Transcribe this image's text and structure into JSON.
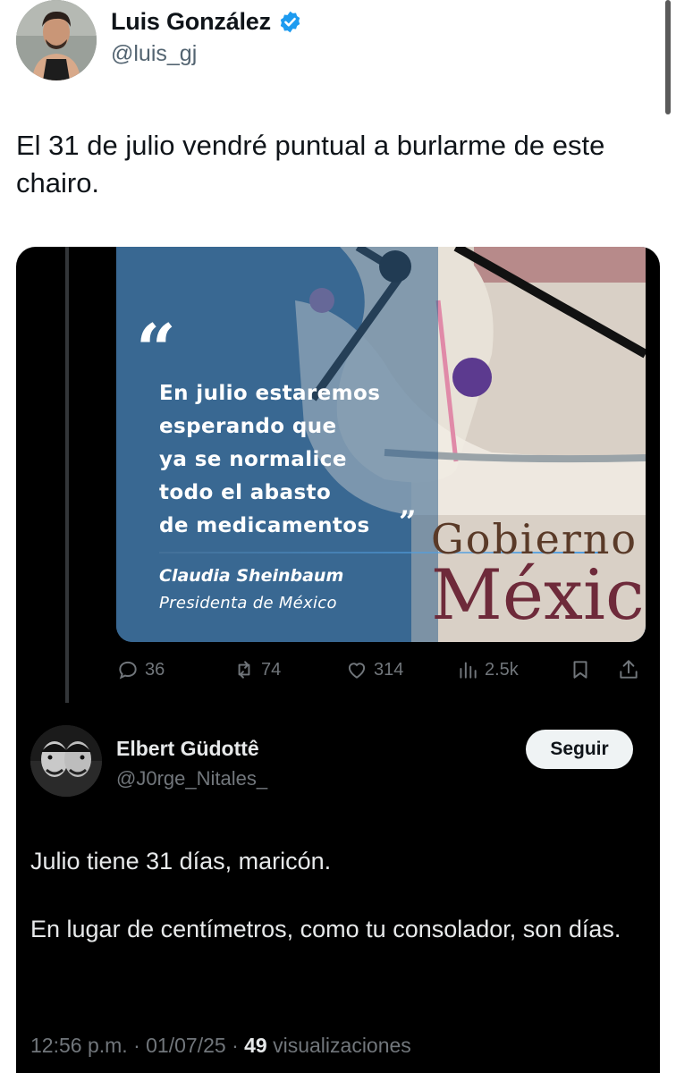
{
  "author": {
    "name": "Luis González",
    "handle": "@luis_gj",
    "verified": true,
    "verified_color": "#1d9bf0"
  },
  "tweet": {
    "text": "El 31 de julio vendré puntual a burlarme de este chairo."
  },
  "quoted": {
    "image": {
      "quote_open": "“",
      "quote_lines": [
        "En julio estaremos",
        "esperando que",
        "ya se normalice",
        "todo el abasto",
        "de medicamentos"
      ],
      "quote_close": "”",
      "speaker": "Claudia Sheinbaum",
      "speaker_role": "Presidenta de México",
      "brand_line1": "Gobierno",
      "brand_line2": "México"
    },
    "actions": {
      "replies": "36",
      "reposts": "74",
      "likes": "314",
      "views": "2.5k"
    },
    "reply": {
      "name": "Elbert Güdottê",
      "handle": "@J0rge_Nitales_",
      "follow_label": "Seguir",
      "paragraphs": [
        "Julio tiene 31 días, maricón.",
        "En lugar de centímetros, como tu consolador, son días."
      ],
      "time": "12:56 p.m.",
      "date": "01/07/25",
      "views_count": "49",
      "views_label": "visualizaciones"
    }
  },
  "icons": {
    "verified": "verified-badge-icon",
    "reply": "speech-bubble-icon",
    "repost": "repost-arrows-icon",
    "like": "heart-icon",
    "views": "bar-chart-icon",
    "bookmark": "bookmark-icon",
    "share": "share-upload-icon"
  }
}
